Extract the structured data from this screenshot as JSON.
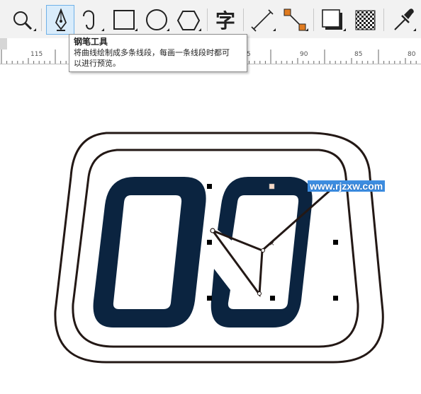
{
  "toolbar": {
    "tools": [
      {
        "name": "zoom-tool"
      },
      {
        "name": "pen-tool",
        "active": true
      },
      {
        "name": "bezier-tool"
      },
      {
        "name": "rectangle-tool"
      },
      {
        "name": "ellipse-tool"
      },
      {
        "name": "polygon-tool"
      },
      {
        "name": "text-tool",
        "glyph": "字"
      },
      {
        "name": "dimension-tool"
      },
      {
        "name": "connector-tool"
      },
      {
        "name": "drop-shadow-tool"
      },
      {
        "name": "transparency-tool"
      },
      {
        "name": "eyedropper-tool"
      }
    ]
  },
  "tooltip": {
    "title": "钢笔工具",
    "line1": "将曲线绘制成多条线段，每画一条线段时都可",
    "line2": "以进行预览。"
  },
  "ruler": {
    "labels": [
      "115",
      "5",
      "90",
      "85",
      "80"
    ]
  },
  "canvas": {
    "watermark": "www.rjzxw.com",
    "colors": {
      "outline": "#231815",
      "digit_fill": "#0b2440",
      "handle": "#000000",
      "accent": "#e07b1f"
    }
  }
}
